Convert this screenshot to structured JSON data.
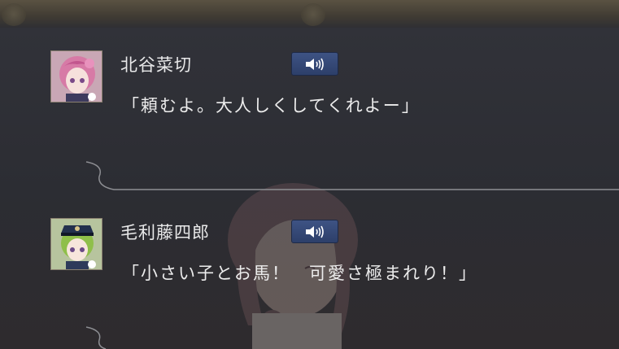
{
  "dialogue": [
    {
      "speaker": "北谷菜切",
      "line": "「頼むよ。大人しくしてくれよー」",
      "portrait_icon": "character-portrait-pink-hair",
      "voice_icon": "speaker-icon"
    },
    {
      "speaker": "毛利藤四郎",
      "line": "「小さい子とお馬！　可愛さ極まれり！」",
      "portrait_icon": "character-portrait-green-hair",
      "voice_icon": "speaker-icon"
    }
  ],
  "colors": {
    "panel_bg": "#2b2c31",
    "voice_button": "#34497a",
    "text": "#ececec"
  }
}
